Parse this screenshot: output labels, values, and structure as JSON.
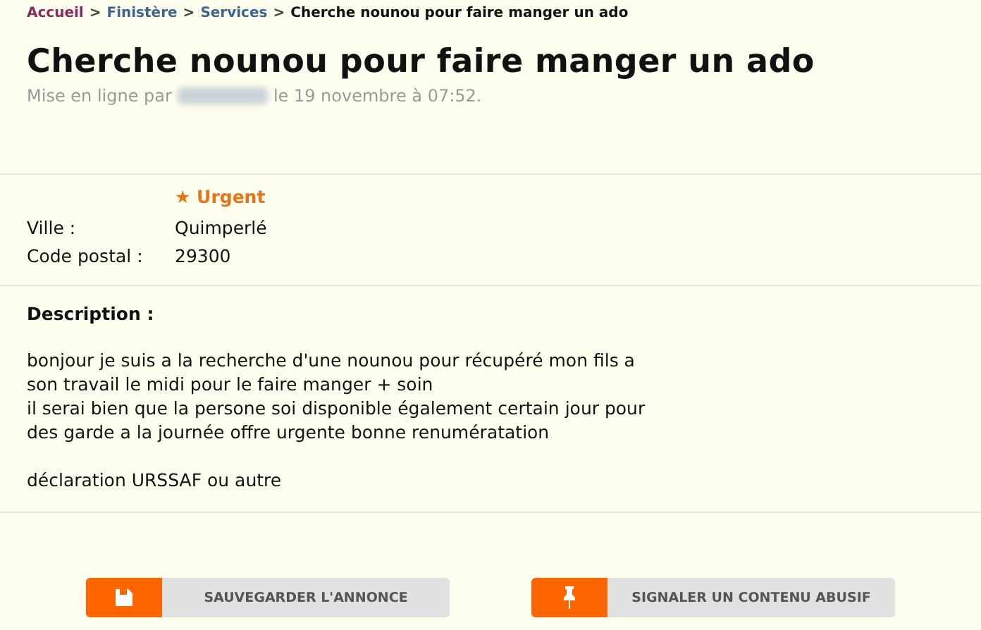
{
  "breadcrumb": [
    {
      "label": "Accueil",
      "kind": "home"
    },
    {
      "label": "Finistère",
      "kind": "link"
    },
    {
      "label": "Services",
      "kind": "link"
    },
    {
      "label": "Cherche nounou pour faire manger un ado",
      "kind": "current"
    }
  ],
  "breadcrumb_separator": ">",
  "title": "Cherche nounou pour faire manger un ado",
  "posted": {
    "prefix": "Mise en ligne par",
    "author_blurred": true,
    "suffix": "le 19 novembre à 07:52."
  },
  "urgent_badge": "★ Urgent",
  "details": [
    {
      "label": "Ville :",
      "value": "Quimperlé"
    },
    {
      "label": "Code postal :",
      "value": "29300"
    }
  ],
  "description": {
    "heading": "Description :",
    "paragraphs": [
      "bonjour je suis a la recherche d'une nounou pour récupéré mon fils a\nson travail le midi pour le faire manger + soin\nil serai bien que la persone soi disponible également certain jour pour\ndes garde a la journée offre urgente bonne renumératation",
      "déclaration URSSAF ou autre"
    ]
  },
  "buttons": [
    {
      "label": "SAUVEGARDER L'ANNONCE",
      "kind": "save"
    },
    {
      "label": "SIGNALER UN CONTENU ABUSIF",
      "kind": "report"
    }
  ]
}
